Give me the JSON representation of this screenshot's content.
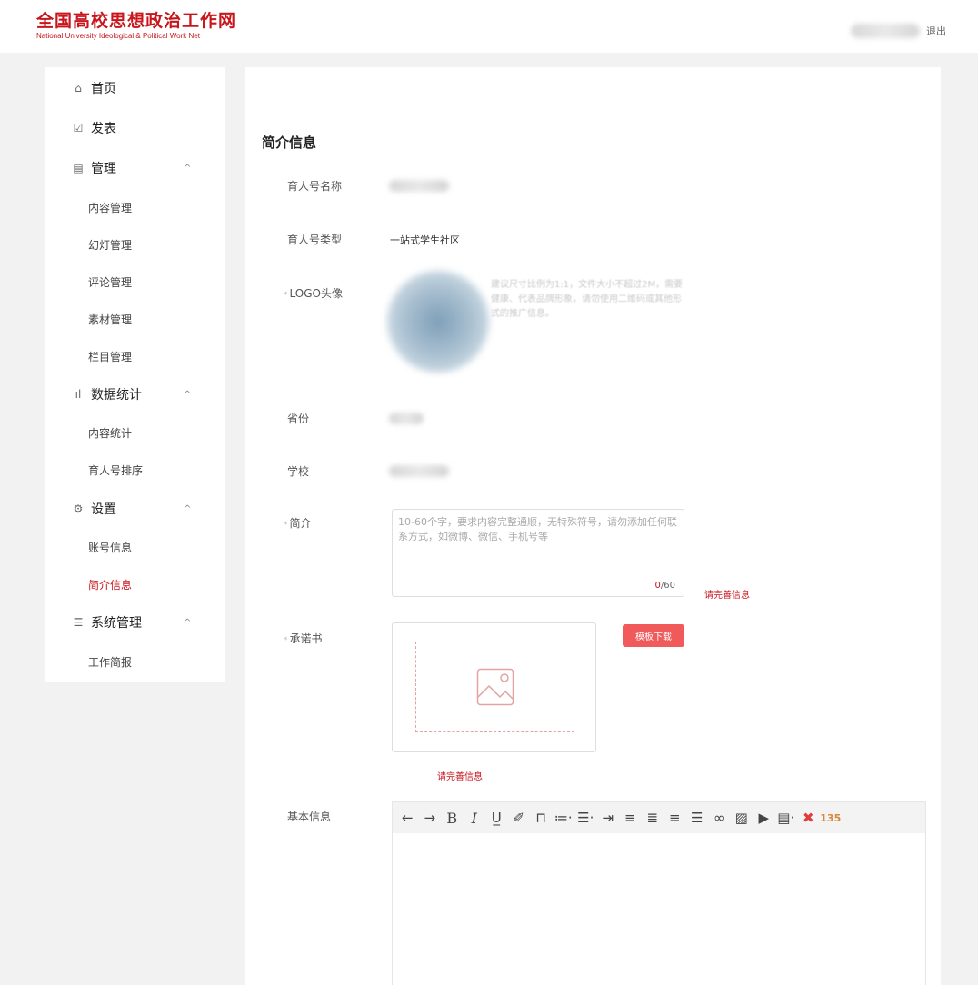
{
  "header": {
    "logo_title": "全国高校思想政治工作网",
    "logo_subtitle": "National University Ideological & Political Work Net",
    "logout": "退出"
  },
  "sidebar": {
    "items": [
      {
        "type": "menu",
        "icon": "⌂",
        "label": "首页"
      },
      {
        "type": "menu",
        "icon": "☑",
        "label": "发表"
      },
      {
        "type": "menu",
        "icon": "▤",
        "label": "管理",
        "expanded": true
      },
      {
        "type": "sub",
        "label": "内容管理"
      },
      {
        "type": "sub",
        "label": "幻灯管理"
      },
      {
        "type": "sub",
        "label": "评论管理"
      },
      {
        "type": "sub",
        "label": "素材管理"
      },
      {
        "type": "sub",
        "label": "栏目管理"
      },
      {
        "type": "menu",
        "icon": "ıl",
        "label": "数据统计",
        "expanded": true
      },
      {
        "type": "sub",
        "label": "内容统计"
      },
      {
        "type": "sub",
        "label": "育人号排序"
      },
      {
        "type": "menu",
        "icon": "⚙",
        "label": "设置",
        "expanded": true
      },
      {
        "type": "sub",
        "label": "账号信息"
      },
      {
        "type": "sub",
        "label": "简介信息",
        "active": true
      },
      {
        "type": "menu",
        "icon": "☰",
        "label": "系统管理",
        "expanded": true
      },
      {
        "type": "sub",
        "label": "工作简报"
      }
    ],
    "arrow": "^",
    "active_color": "#c8161d"
  },
  "main": {
    "section_title": "简介信息",
    "fields": {
      "name_label": "育人号名称",
      "type_label": "育人号类型",
      "type_value": "一站式学生社区",
      "logo_label": "LOGO头像",
      "logo_hint": "建议尺寸比例为1:1，文件大小不超过2M，需要健康、代表品牌形象，请勿使用二维码或其他形式的推广信息。",
      "province_label": "省份",
      "school_label": "学校",
      "intro_label": "简介",
      "intro_placeholder": "10-60个字，要求内容完整通顺，无特殊符号，请勿添加任何联系方式，如微博、微信、手机号等",
      "intro_count": "0",
      "intro_max": "/60",
      "intro_warning": "请完善信息",
      "pledge_label": "承诺书",
      "template_button": "模板下载",
      "pledge_warning": "请完善信息",
      "basic_label": "基本信息"
    },
    "required_mark": "*",
    "toolbar": [
      {
        "name": "undo-icon",
        "glyph": "←"
      },
      {
        "name": "redo-icon",
        "glyph": "→"
      },
      {
        "name": "bold-icon",
        "glyph": "B"
      },
      {
        "name": "italic-icon",
        "glyph": "I"
      },
      {
        "name": "underline-icon",
        "glyph": "U̲"
      },
      {
        "name": "eraser-icon",
        "glyph": "✐"
      },
      {
        "name": "format-brush-icon",
        "glyph": "⊓"
      },
      {
        "name": "ordered-list-icon",
        "glyph": "≔·"
      },
      {
        "name": "unordered-list-icon",
        "glyph": "☰·"
      },
      {
        "name": "indent-icon",
        "glyph": "⇥"
      },
      {
        "name": "align-left-icon",
        "glyph": "≡"
      },
      {
        "name": "align-center-icon",
        "glyph": "≣"
      },
      {
        "name": "align-right-icon",
        "glyph": "≡"
      },
      {
        "name": "justify-icon",
        "glyph": "☰"
      },
      {
        "name": "link-icon",
        "glyph": "∞"
      },
      {
        "name": "image-icon",
        "glyph": "▨"
      },
      {
        "name": "video-icon",
        "glyph": "▶"
      },
      {
        "name": "template-icon",
        "glyph": "▤·"
      },
      {
        "name": "plugin-icon",
        "glyph": "✖"
      },
      {
        "name": "material-icon",
        "glyph": "135"
      }
    ]
  }
}
